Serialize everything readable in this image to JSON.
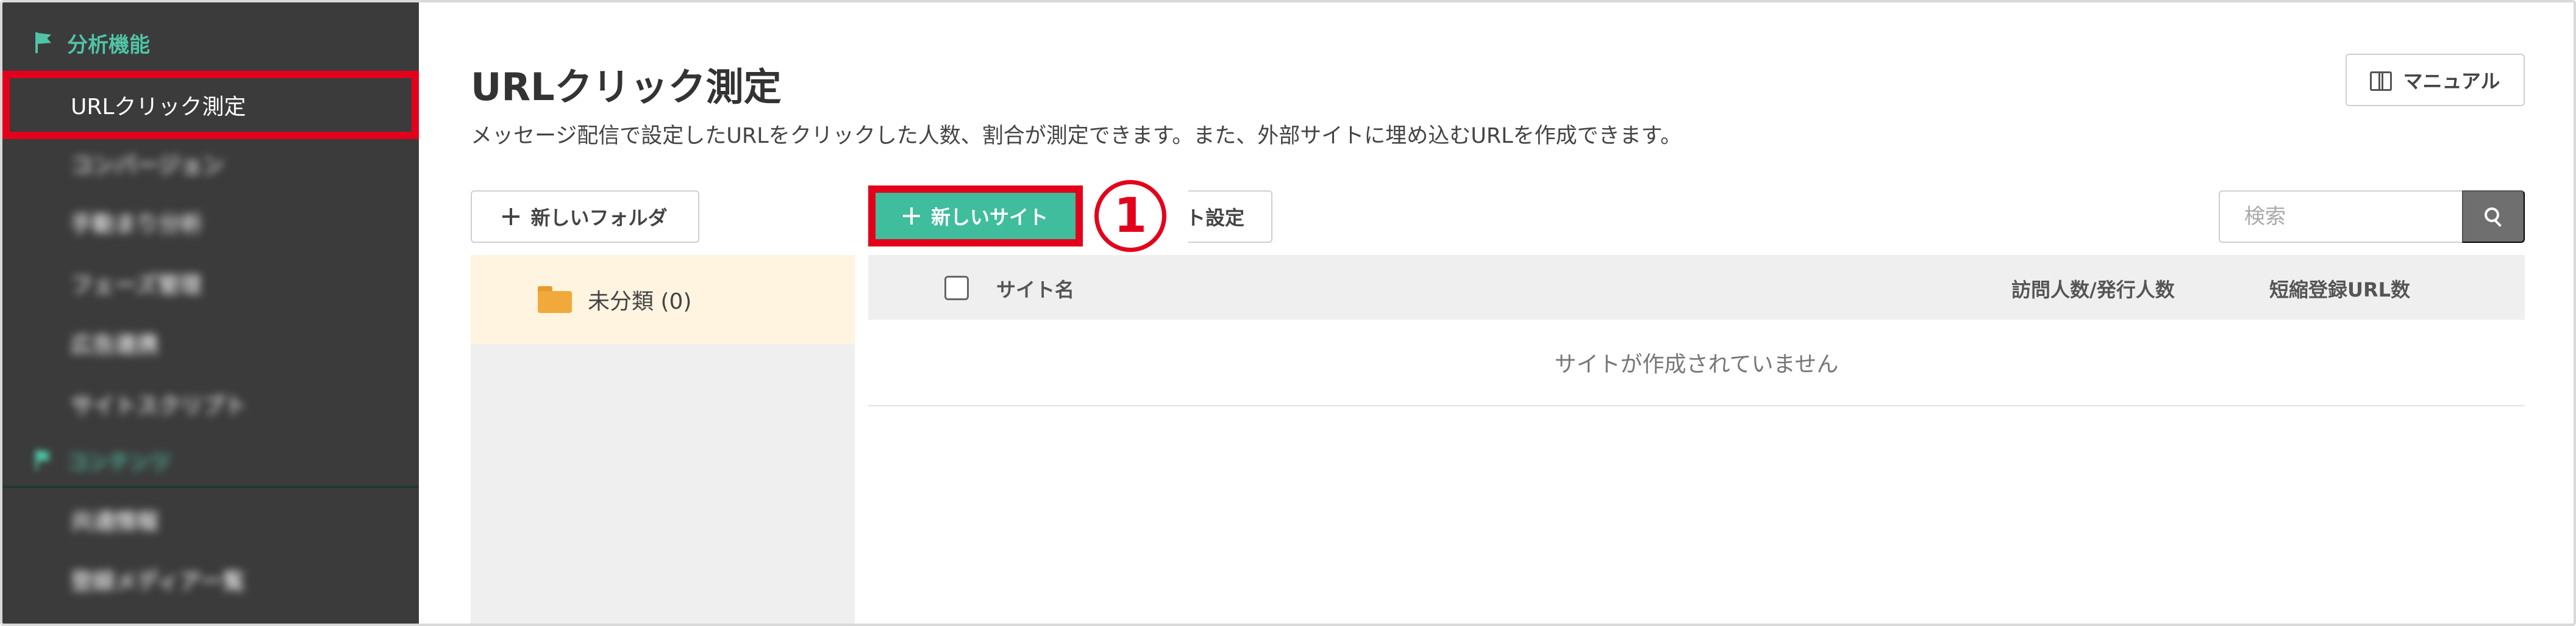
{
  "sidebar": {
    "section_analytics": "分析機能",
    "active_item": "URLクリック測定",
    "blurred_items": [
      "コンバージョン",
      "手動まり分析",
      "フェーズ管理",
      "広告連携",
      "サイトスクリプト"
    ],
    "section_content": "コンテンツ",
    "blurred_items_2": [
      "共通情報",
      "登録メディア一覧"
    ]
  },
  "header": {
    "title": "URLクリック測定",
    "description": "メッセージ配信で設定したURLをクリックした人数、割合が測定できます。また、外部サイトに埋め込むURLを作成できます。",
    "manual_label": "マニュアル"
  },
  "toolbar": {
    "new_folder_label": "新しいフォルダ",
    "new_site_label": "新しいサイト",
    "site_settings_label": "ト設定",
    "step_marker": "1",
    "search_placeholder": "検索"
  },
  "folders": [
    {
      "label": "未分類 (0)"
    }
  ],
  "table": {
    "columns": [
      "サイト名",
      "訪問人数/発行人数",
      "短縮登録URL数"
    ],
    "empty_message": "サイトが作成されていません"
  },
  "colors": {
    "sidebar_bg": "#3b3b3b",
    "accent_green": "#3fbd9c",
    "highlight_red": "#e3001b",
    "folder_orange": "#f2a93b"
  }
}
